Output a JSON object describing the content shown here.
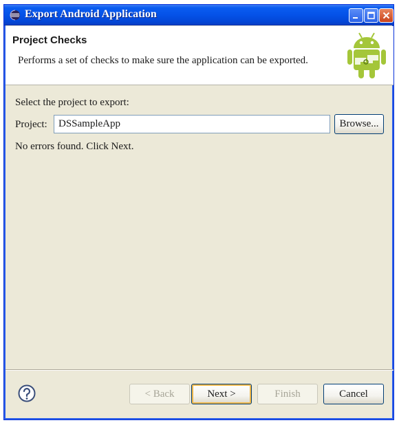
{
  "window": {
    "title": "Export Android Application"
  },
  "banner": {
    "title": "Project Checks",
    "description": "Performs a set of checks to make sure the application can be exported.",
    "icon": "android-icon"
  },
  "form": {
    "select_label": "Select the project to export:",
    "project_label": "Project:",
    "project_value": "DSSampleApp",
    "browse_label": "Browse...",
    "status": "No errors found. Click Next."
  },
  "buttons": {
    "help_icon": "help-icon",
    "back": "< Back",
    "next": "Next >",
    "finish": "Finish",
    "cancel": "Cancel"
  },
  "colors": {
    "titlebar": "#0552e8",
    "dialog_bg": "#ece9d8",
    "android_green": "#a4c639"
  }
}
